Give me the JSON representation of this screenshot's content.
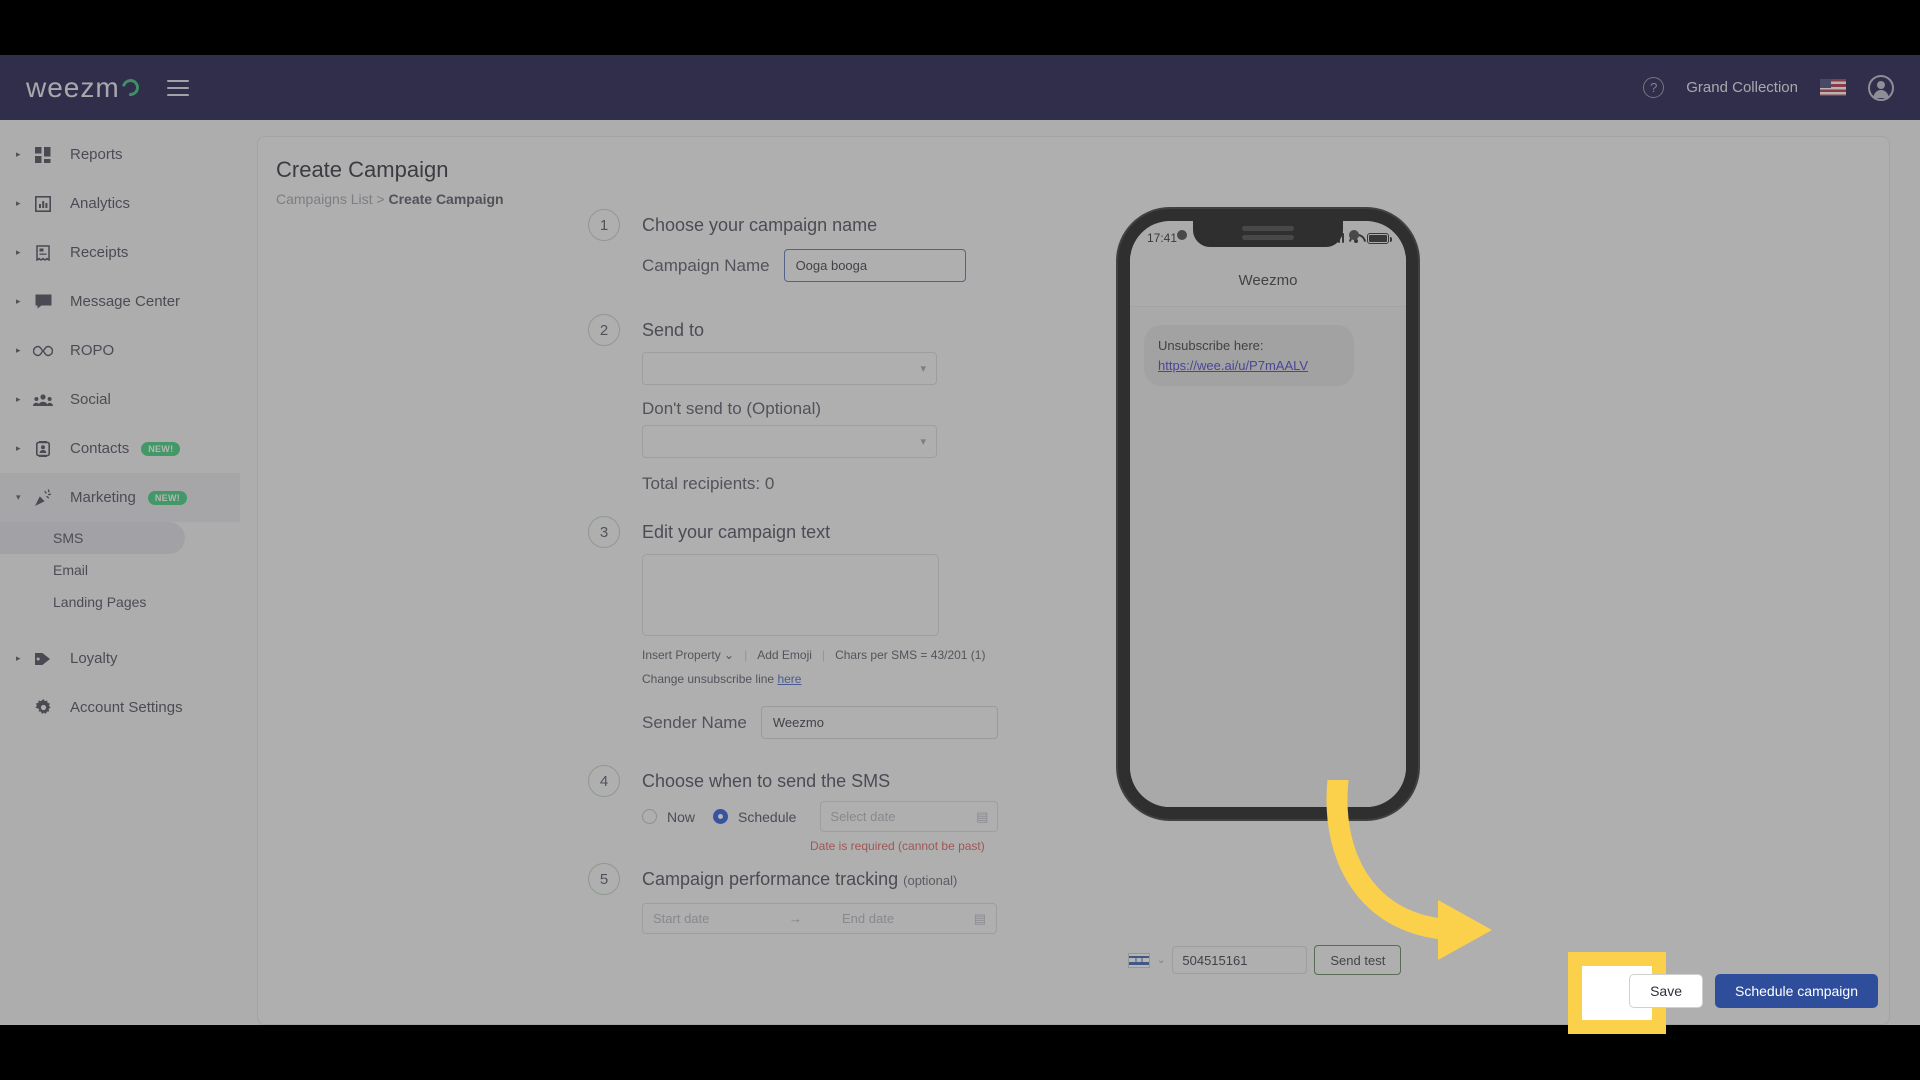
{
  "topbar": {
    "logo_text": "weezm",
    "account_name": "Grand Collection",
    "menu_icon": "hamburger-icon",
    "help_icon": "?",
    "flag": "us-flag"
  },
  "sidebar": {
    "items": [
      {
        "label": "Reports",
        "icon": "dashboard-icon",
        "expandable": true,
        "badge": ""
      },
      {
        "label": "Analytics",
        "icon": "bar-chart-icon",
        "expandable": true,
        "badge": ""
      },
      {
        "label": "Receipts",
        "icon": "receipt-icon",
        "expandable": true,
        "badge": ""
      },
      {
        "label": "Message Center",
        "icon": "chat-icon",
        "expandable": true,
        "badge": ""
      },
      {
        "label": "ROPO",
        "icon": "infinity-icon",
        "expandable": true,
        "badge": ""
      },
      {
        "label": "Social",
        "icon": "people-icon",
        "expandable": true,
        "badge": ""
      },
      {
        "label": "Contacts",
        "icon": "contact-card-icon",
        "expandable": true,
        "badge": "NEW!"
      },
      {
        "label": "Marketing",
        "icon": "party-popper-icon",
        "expandable": true,
        "badge": "NEW!"
      }
    ],
    "marketing_sub": [
      {
        "label": "SMS",
        "selected": true
      },
      {
        "label": "Email",
        "selected": false
      },
      {
        "label": "Landing Pages",
        "selected": false
      }
    ],
    "bottom_items": [
      {
        "label": "Loyalty",
        "icon": "tag-icon",
        "expandable": true
      },
      {
        "label": "Account Settings",
        "icon": "gear-icon",
        "expandable": false
      }
    ]
  },
  "page": {
    "title": "Create Campaign",
    "breadcrumb_root": "Campaigns List",
    "breadcrumb_sep": ">",
    "breadcrumb_current": "Create Campaign"
  },
  "steps": {
    "one": {
      "num": "1",
      "title": "Choose your campaign name",
      "field_label": "Campaign Name",
      "field_value": "Ooga booga"
    },
    "two": {
      "num": "2",
      "title": "Send to",
      "send_to_value": "",
      "dont_send_label": "Don't send to (Optional)",
      "dont_send_value": "",
      "total_recipients": "Total recipients: 0"
    },
    "three": {
      "num": "3",
      "title": "Edit your campaign text",
      "body_value": "",
      "insert_property": "Insert Property",
      "add_emoji": "Add Emoji",
      "chars_counter": "Chars per SMS = 43/201 (1)",
      "unsub_prefix": "Change unsubscribe line",
      "unsub_link": "here",
      "sender_label": "Sender Name",
      "sender_value": "Weezmo"
    },
    "four": {
      "num": "4",
      "title": "Choose when to send the SMS",
      "radio_now": "Now",
      "radio_schedule": "Schedule",
      "selected_radio": "Schedule",
      "date_placeholder": "Select date",
      "error": "Date is required (cannot be past)"
    },
    "five": {
      "num": "5",
      "title": "Campaign performance tracking",
      "title_optional": "(optional)",
      "start_placeholder": "Start date",
      "range_arrow": "→",
      "end_placeholder": "End date"
    }
  },
  "preview": {
    "status_time": "17:41",
    "header_title": "Weezmo",
    "message_text": "Unsubscribe here:",
    "message_link": "https://wee.ai/u/P7mAALV"
  },
  "test_send": {
    "country": "IL",
    "phone_value": "504515161",
    "button_label": "Send test"
  },
  "actions": {
    "save_label": "Save",
    "schedule_label": "Schedule campaign"
  },
  "colors": {
    "topbar": "#0d0a3c",
    "primary_button": "#2e4d9b",
    "highlight": "#fbd14b",
    "badge_green": "#2ecc71",
    "error_red": "#d9534f",
    "link_blue": "#3b5bbf"
  }
}
